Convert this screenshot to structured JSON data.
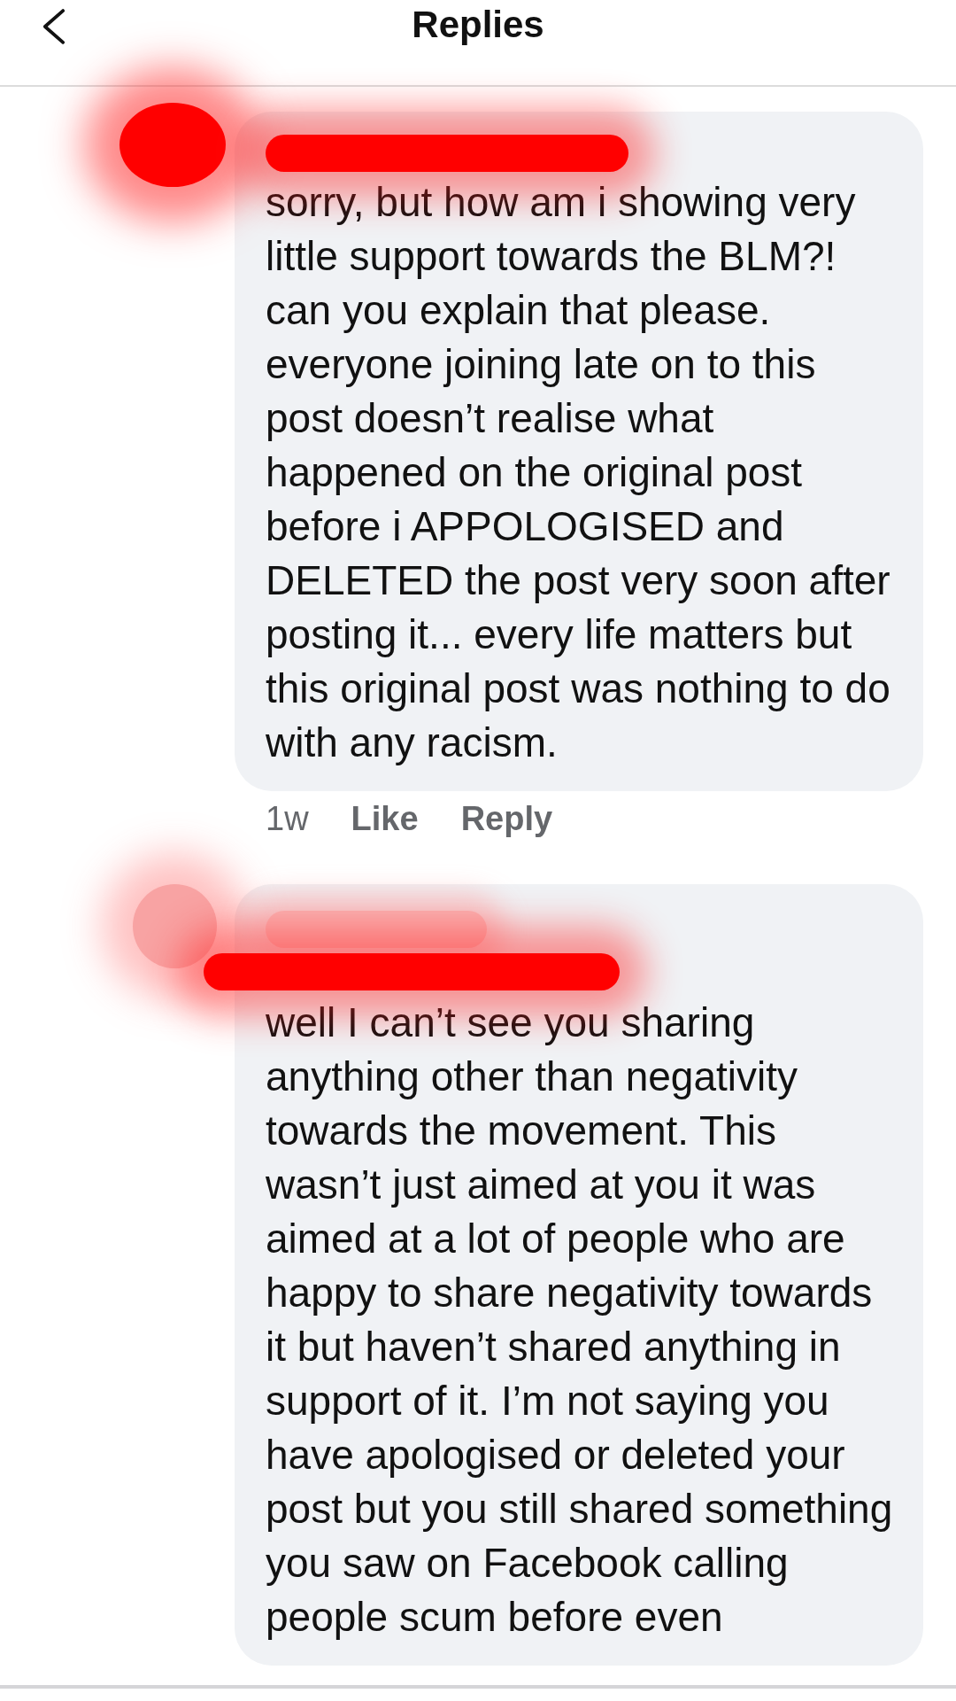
{
  "header": {
    "title": "Replies"
  },
  "comments": [
    {
      "text": "sorry, but how am i showing very little support towards the BLM?! can you explain that please. everyone joining late on to this post doesn’t realise what happened on the original post before i APPOLOGISED and DELETED the post very soon after posting it... every life matters but this original post was nothing to do with any racism.",
      "name_inline": false,
      "time": "1w",
      "actions": [
        "Like",
        "Reply"
      ]
    },
    {
      "text": "well I can’t see you sharing anything other than negativity towards the movement. This wasn’t just aimed at you it was aimed at a lot of people who are happy to share negativity towards it but haven’t shared anything in support of it. I’m not saying you have apologised or deleted your post but you still shared something you saw on Facebook calling people scum before even",
      "name_inline": true
    }
  ]
}
